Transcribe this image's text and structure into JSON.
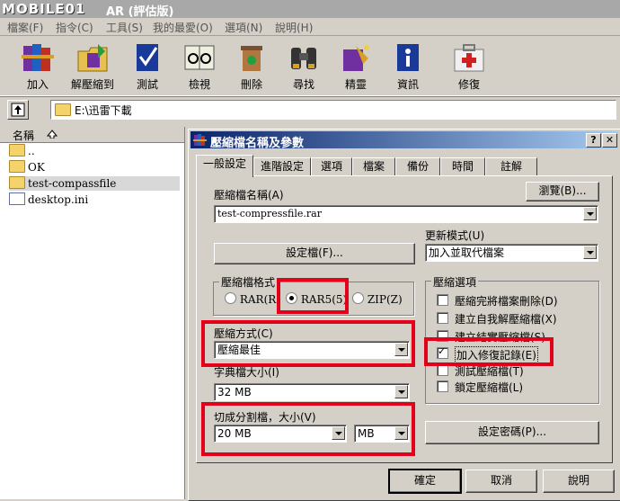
{
  "titlebar": {
    "brand": "MOBILE01",
    "title": "AR (評估版)"
  },
  "menu": [
    "檔案(F)",
    "指令(C)",
    "工具(S)",
    "我的最愛(O)",
    "選項(N)",
    "說明(H)"
  ],
  "toolbar": [
    "加入",
    "解壓縮到",
    "測試",
    "檢視",
    "刪除",
    "尋找",
    "精靈",
    "資訊",
    "修復"
  ],
  "address": {
    "path": "E:\\迅雷下載"
  },
  "filelist": {
    "header": "名稱",
    "items": [
      "..",
      "OK",
      "test-compassfile",
      "desktop.ini"
    ]
  },
  "dialog": {
    "title": "壓縮檔名稱及參數",
    "help_btn": "?",
    "close_btn": "✕",
    "tabs": [
      "一般設定",
      "進階設定",
      "選項",
      "檔案",
      "備份",
      "時間",
      "註解"
    ],
    "archive_name_label": "壓縮檔名稱(A)",
    "browse": "瀏覽(B)...",
    "archive_name": "test-compressfile.rar",
    "update_mode_label": "更新模式(U)",
    "update_mode": "加入並取代檔案",
    "profiles": "設定檔(F)...",
    "format_group": "壓縮檔格式",
    "formats": [
      "RAR(R)",
      "RAR5(5)",
      "ZIP(Z)"
    ],
    "selected_format": "RAR5(5)",
    "method_label": "壓縮方式(C)",
    "method": "壓縮最佳",
    "dict_label": "字典檔大小(I)",
    "dict": "32 MB",
    "split_label": "切成分割檔，大小(V)",
    "split_size": "20 MB",
    "split_unit": "MB",
    "options_group": "壓縮選項",
    "options": [
      {
        "label": "壓縮完將檔案刪除(D)",
        "checked": false
      },
      {
        "label": "建立自我解壓縮檔(X)",
        "checked": false
      },
      {
        "label": "建立結實壓縮檔(S)",
        "checked": false
      },
      {
        "label": "加入修復記錄(E)",
        "checked": true
      },
      {
        "label": "測試壓縮檔(T)",
        "checked": false
      },
      {
        "label": "鎖定壓縮檔(L)",
        "checked": false
      }
    ],
    "password": "設定密碼(P)...",
    "ok": "確定",
    "cancel": "取消",
    "help": "說明"
  },
  "colors": {
    "highlight": "#e3001b",
    "titlebar": "#0a246a"
  }
}
